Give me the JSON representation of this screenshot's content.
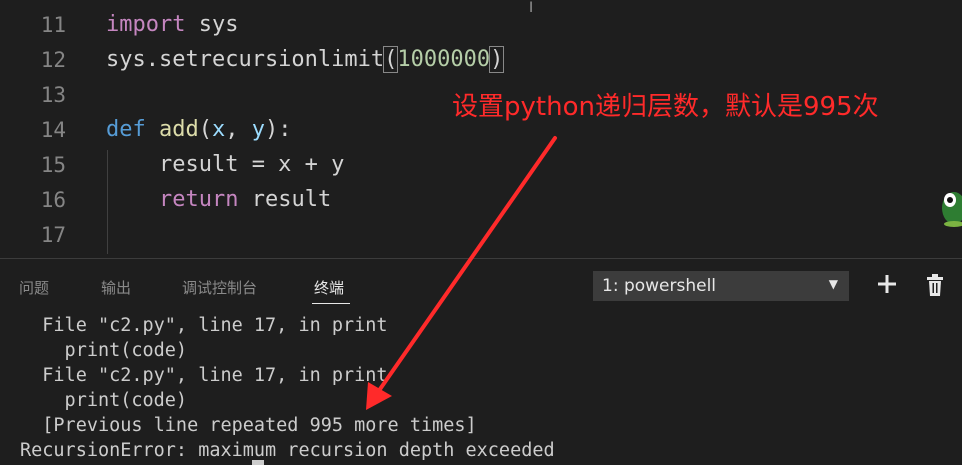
{
  "editor": {
    "lines": [
      {
        "num": "11",
        "tokens": [
          {
            "t": "import",
            "c": "kw"
          },
          {
            "t": " sys",
            "c": "plain"
          }
        ]
      },
      {
        "num": "12",
        "tokens": [
          {
            "t": "sys.setrecursionlimit",
            "c": "plain"
          },
          {
            "t": "(",
            "c": "plain"
          },
          {
            "t": "1000000",
            "c": "num"
          },
          {
            "t": ")",
            "c": "plain"
          }
        ]
      },
      {
        "num": "13",
        "tokens": []
      },
      {
        "num": "14",
        "tokens": [
          {
            "t": "def",
            "c": "kw2"
          },
          {
            "t": " ",
            "c": "plain"
          },
          {
            "t": "add",
            "c": "fn"
          },
          {
            "t": "(",
            "c": "plain"
          },
          {
            "t": "x",
            "c": "var"
          },
          {
            "t": ", ",
            "c": "plain"
          },
          {
            "t": "y",
            "c": "var"
          },
          {
            "t": "):",
            "c": "plain"
          }
        ]
      },
      {
        "num": "15",
        "tokens": [
          {
            "t": "    result = x + y",
            "c": "plain"
          }
        ]
      },
      {
        "num": "16",
        "tokens": [
          {
            "t": "    ",
            "c": "plain"
          },
          {
            "t": "return",
            "c": "kw"
          },
          {
            "t": " result",
            "c": "plain"
          }
        ]
      },
      {
        "num": "17",
        "tokens": []
      }
    ]
  },
  "annotation": {
    "text": "设置python递归层数，默认是995次",
    "color": "#ff2a2a"
  },
  "panel": {
    "tabs": [
      "问题",
      "输出",
      "调试控制台",
      "终端"
    ],
    "active_tab": "终端",
    "terminal_select": "1: powershell",
    "add_icon": "plus-icon",
    "delete_icon": "trash-icon"
  },
  "terminal": {
    "lines": [
      "  File \"c2.py\", line 17, in print",
      "    print(code)",
      "  File \"c2.py\", line 17, in print",
      "    print(code)",
      "  [Previous line repeated 995 more times]",
      "RecursionError: maximum recursion depth exceeded"
    ]
  },
  "colors": {
    "background": "#1e1e1e",
    "keyword": "#c586c0",
    "def_keyword": "#569cd6",
    "function": "#dcdcaa",
    "number": "#b5cea8",
    "variable": "#9cdcfe",
    "annotation_red": "#ff2a2a"
  }
}
